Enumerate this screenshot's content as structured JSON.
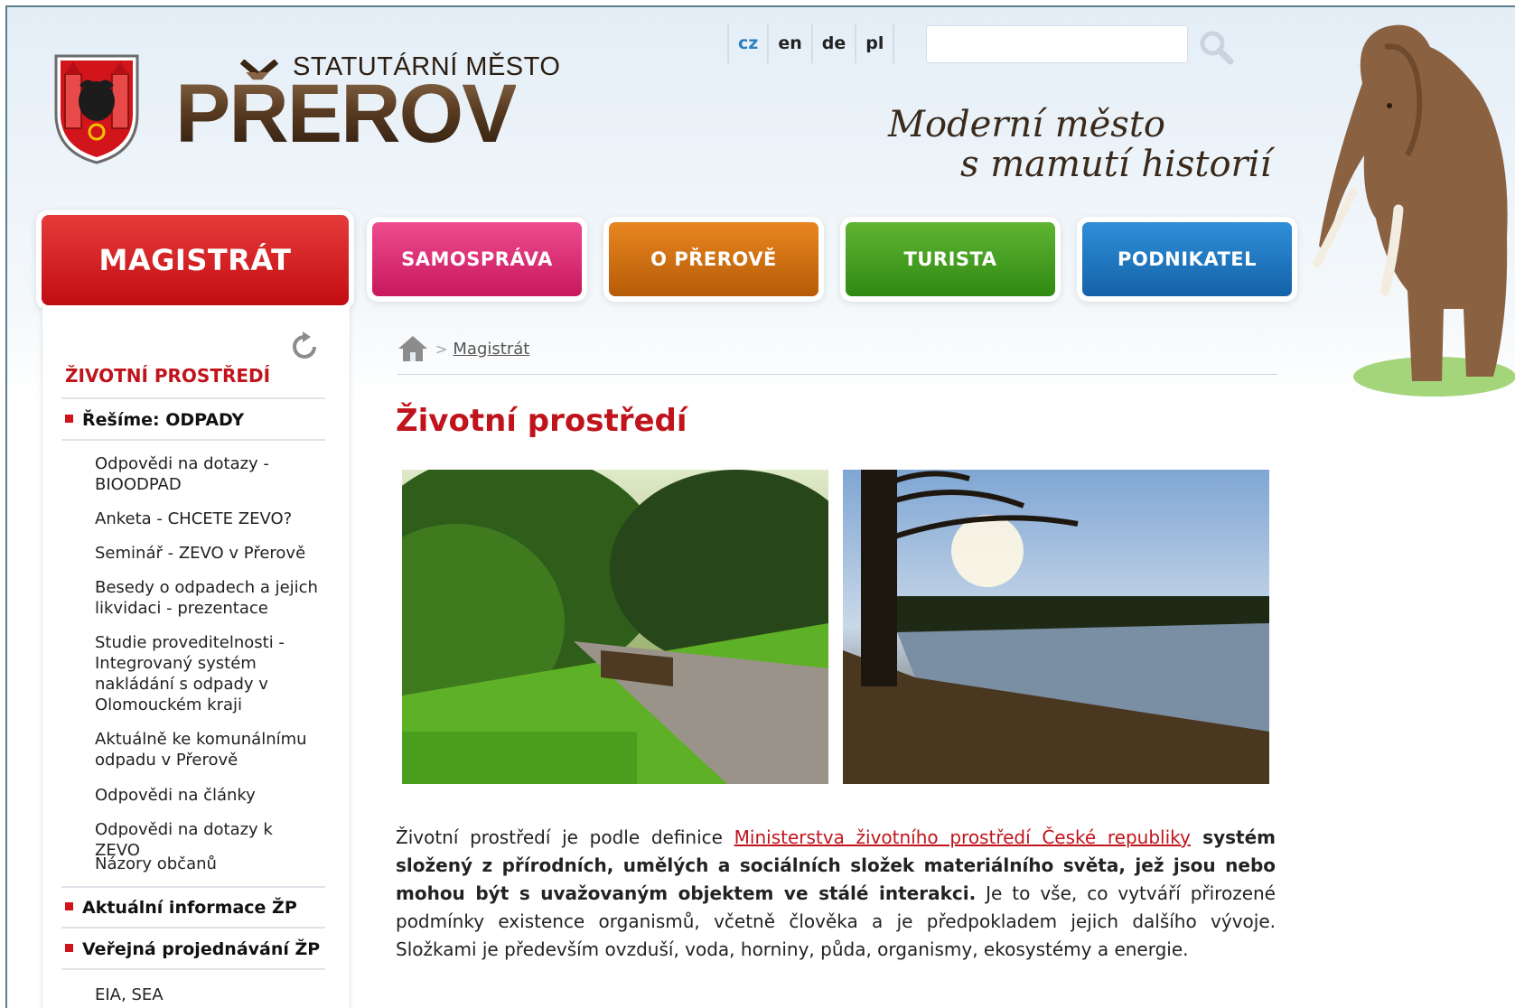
{
  "header": {
    "logo_subtitle": "STATUTÁRNÍ MĚSTO",
    "logo_title": "PŘEROV",
    "languages": [
      "cz",
      "en",
      "de",
      "pl"
    ],
    "active_language": "cz",
    "search": {
      "placeholder": "",
      "value": ""
    },
    "slogan_line1": "Moderní město",
    "slogan_line2": "s mamutí historií"
  },
  "nav": {
    "active": "MAGISTRÁT",
    "items": [
      "SAMOSPRÁVA",
      "O PŘEROVĚ",
      "TURISTA",
      "PODNIKATEL"
    ]
  },
  "sidebar": {
    "title": "ŽIVOTNÍ PROSTŘEDÍ",
    "section1": "Řešíme: ODPADY",
    "sub": [
      "Odpovědi na dotazy - BIOODPAD",
      "Anketa - CHCETE ZEVO?",
      "Seminář - ZEVO v Přerově",
      "Besedy o odpadech a jejich likvidaci - prezentace",
      "Studie proveditelnosti - Integrovaný systém nakládání s odpady v Olomouckém kraji",
      "Aktuálně ke komunálnímu odpadu v Přerově",
      "Odpovědi na články",
      "Odpovědi na dotazy k ZEVO",
      "Názory občanů"
    ],
    "section2": "Aktuální informace ŽP",
    "section3": "Veřejná projednávání ŽP",
    "sub2": [
      "EIA, SEA"
    ]
  },
  "breadcrumb": {
    "separator": ">",
    "link": "Magistrát"
  },
  "main": {
    "title": "Životní prostředí",
    "text_before": "Životní prostředí je podle definice ",
    "link": "Ministerstva životního prostředí České republiky",
    "text_bold": " systém složený z přírodních, umělých a sociálních složek materiálního světa, jež jsou nebo mohou být s uvažovaným objektem ve stálé interakci.",
    "text_after": " Je to vše, co vytváří přirozené podmínky existence organismů, včetně člověka a je předpokladem jejich dalšího vývoje. Složkami je především ovzduší, voda, horniny, půda, organismy, ekosystémy a energie."
  },
  "colors": {
    "accent_red": "#c0141c",
    "magistrat": "#d9161c",
    "samosprava": "#d81e6c",
    "o_prerove": "#cf6e12",
    "turista": "#3f9b1c",
    "podnikatel": "#1f78c4"
  },
  "icons": [
    "coat-of-arms-icon",
    "search-icon",
    "mammoth-icon",
    "refresh-icon",
    "home-icon"
  ]
}
